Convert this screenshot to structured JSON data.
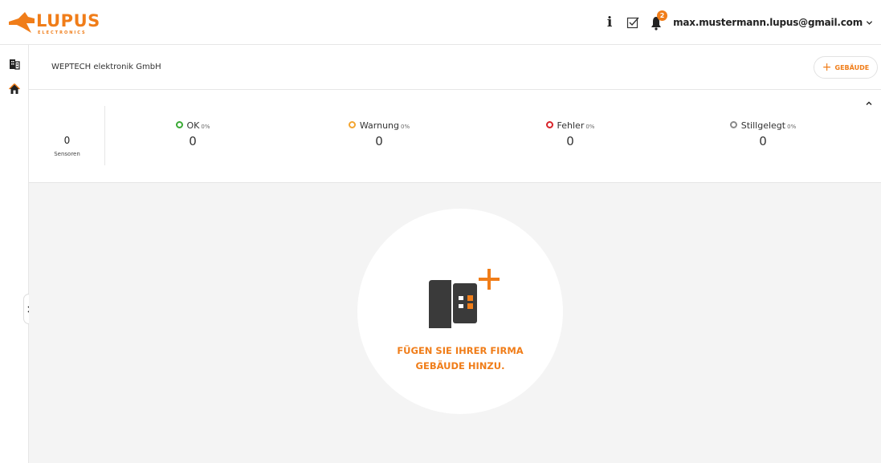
{
  "brand": {
    "name": "LUPUS",
    "tagline": "ELECTRONICS",
    "accent": "#f07d19"
  },
  "header": {
    "notification_count": "2",
    "user_email": "max.mustermann.lupus@gmail.com",
    "info_label": "i"
  },
  "company": {
    "name": "WEPTECH elektronik GmbH",
    "add_building_label": "GEBÄUDE"
  },
  "stats": {
    "sensor_count": "0",
    "sensor_label": "Sensoren",
    "items": [
      {
        "label": "OK",
        "percent": "0%",
        "value": "0",
        "color": "#3aaa35"
      },
      {
        "label": "Warnung",
        "percent": "0%",
        "value": "0",
        "color": "#f3a530"
      },
      {
        "label": "Fehler",
        "percent": "0%",
        "value": "0",
        "color": "#d8232a"
      },
      {
        "label": "Stillgelegt",
        "percent": "0%",
        "value": "0",
        "color": "#8a8a8a"
      }
    ]
  },
  "empty_state": {
    "line1": "FÜGEN SIE IHRER FIRMA",
    "line2": "GEBÄUDE HINZU."
  },
  "icons": [
    "fox-logo-icon",
    "info-icon",
    "checkbox-icon",
    "bell-icon",
    "chevron-down-icon",
    "building-icon",
    "home-icon",
    "chevron-right-icon",
    "plus-icon",
    "chevron-up-icon",
    "add-building-icon"
  ]
}
